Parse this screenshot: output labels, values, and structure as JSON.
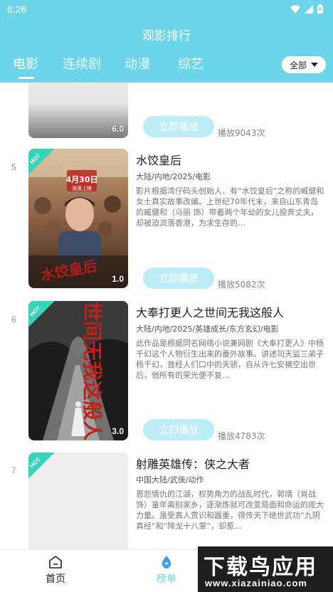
{
  "status": {
    "time": "6:26"
  },
  "header": {
    "title": "观影排行"
  },
  "tabs": [
    {
      "label": "电影",
      "active": true
    },
    {
      "label": "连续剧",
      "active": false
    },
    {
      "label": "动漫",
      "active": false
    },
    {
      "label": "综艺",
      "active": false
    }
  ],
  "filter": {
    "label": "全部"
  },
  "items": [
    {
      "rank": "",
      "score": "6.0",
      "play_label": "立即播放",
      "plays": "播放9043次"
    },
    {
      "rank": "5",
      "title": "水饺皇后",
      "tags": "大陆/内地/2025/电影",
      "description": "影片根据湾仔码头创始人、有“水饺皇后”之称的臧健和女士真实故事改编。上世纪70年代末，来自山东青岛的臧健和（马丽 饰）带着两个年幼的女儿投奔丈夫，却被迫流落香港，为求生存的…",
      "score": "1.0",
      "hot": "HOT",
      "poster_text": {
        "date": "4月30日",
        "date_sub": "浩荡上映",
        "calligraphy": "水饺皇后"
      },
      "play_label": "立即播放",
      "plays": "播放5082次"
    },
    {
      "rank": "6",
      "title": "大奉打更人之世间无我这般人",
      "tags": "大陆/内地/2025/英雄成长/东方玄幻/电影",
      "description": "此作品是根据同名网络小说兼网剧《大奉打更人》中杨千幻这个人物衍生出来的番外故事。讲述司天监三弟子杨千幻，曾经人们口中的天骄，自从许七安横空出世后，他所有的荣光便不复…",
      "score": "3.0",
      "hot": "HOT",
      "poster_text": {
        "calligraphy": "世间无我这般人"
      },
      "play_label": "立即播放",
      "plays": "播放4783次"
    },
    {
      "rank": "7",
      "title": "射雕英雄传：侠之大者",
      "tags": "中国大陆/武侠/动作",
      "description": "恩怨情仇的江湖，权势角力的战乱时代，郭靖（肖战 饰）童年离别家乡，逐渐炼就可改变局面和命运的庞大力量。虽受高人赏识和器重，得传天下绝世武功“九阴真经”和“降龙十八掌”，却惹…",
      "hot": "HOT"
    }
  ],
  "bottom_nav": [
    {
      "label": "首页",
      "active": false
    },
    {
      "label": "榜单",
      "active": true
    }
  ],
  "watermark": {
    "main": "下载鸟应用",
    "sub": "www.xiazainiao.com"
  },
  "colors": {
    "accent": "#6cd5ea",
    "hot_badge": "#35d4b9",
    "play_button": "#bdeef7"
  }
}
